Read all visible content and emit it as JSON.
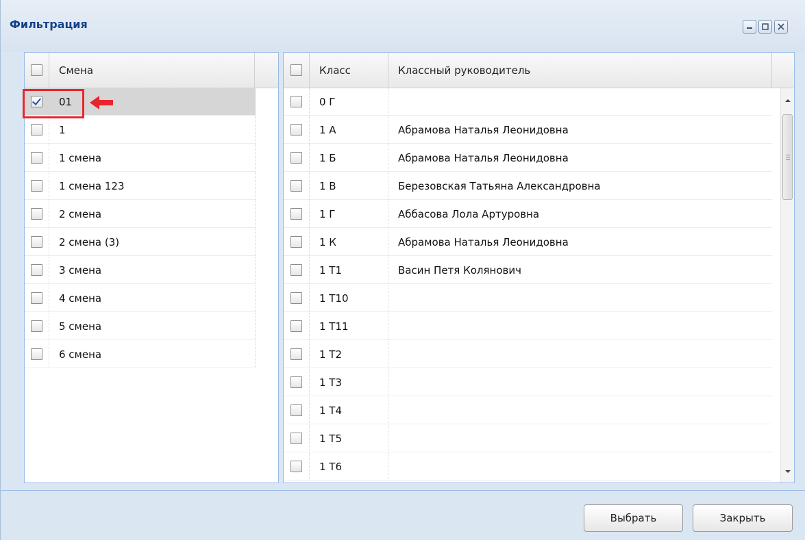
{
  "window": {
    "title": "Фильтрация",
    "controls": [
      "minimize-icon",
      "maximize-icon",
      "close-icon"
    ]
  },
  "shifts_grid": {
    "header": "Смена",
    "rows": [
      {
        "label": "01",
        "checked": true,
        "selected": true
      },
      {
        "label": "1",
        "checked": false
      },
      {
        "label": "1 смена",
        "checked": false
      },
      {
        "label": "1 смена 123",
        "checked": false
      },
      {
        "label": "2 смена",
        "checked": false
      },
      {
        "label": "2 смена (3)",
        "checked": false
      },
      {
        "label": "3 смена",
        "checked": false
      },
      {
        "label": "4 смена",
        "checked": false
      },
      {
        "label": "5 смена",
        "checked": false
      },
      {
        "label": "6 смена",
        "checked": false
      }
    ]
  },
  "classes_grid": {
    "headers": {
      "class": "Класс",
      "teacher": "Классный руководитель"
    },
    "rows": [
      {
        "class": "0 Г",
        "teacher": ""
      },
      {
        "class": "1 А",
        "teacher": "Абрамова Наталья Леонидовна"
      },
      {
        "class": "1 Б",
        "teacher": "Абрамова Наталья Леонидовна"
      },
      {
        "class": "1 В",
        "teacher": "Березовская Татьяна Александровна"
      },
      {
        "class": "1 Г",
        "teacher": "Аббасова Лола Артуровна"
      },
      {
        "class": "1 К",
        "teacher": "Абрамова Наталья Леонидовна"
      },
      {
        "class": "1 Т1",
        "teacher": "Васин Петя Колянович"
      },
      {
        "class": "1 Т10",
        "teacher": ""
      },
      {
        "class": "1 Т11",
        "teacher": ""
      },
      {
        "class": "1 Т2",
        "teacher": ""
      },
      {
        "class": "1 Т3",
        "teacher": ""
      },
      {
        "class": "1 Т4",
        "teacher": ""
      },
      {
        "class": "1 Т5",
        "teacher": ""
      },
      {
        "class": "1 Т6",
        "teacher": ""
      }
    ]
  },
  "buttons": {
    "select": "Выбрать",
    "close": "Закрыть"
  },
  "colors": {
    "highlight": "#e8252e",
    "header_text": "#15428b",
    "window_bg": "#dbe6f3"
  }
}
